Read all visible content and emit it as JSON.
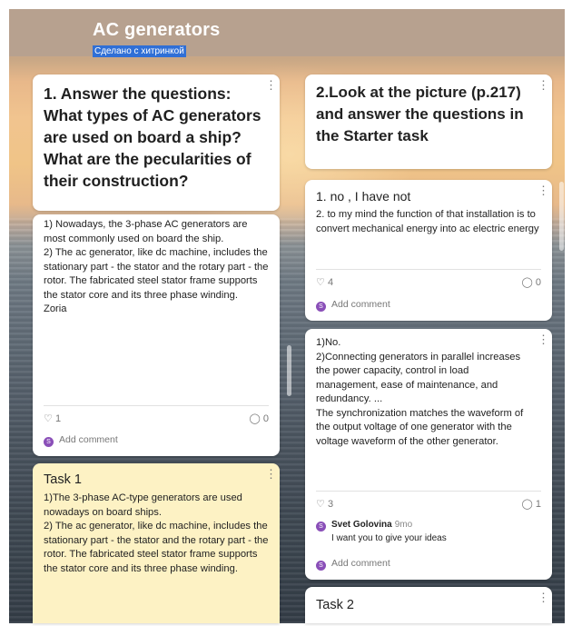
{
  "header": {
    "title": "AC generators",
    "subtitle": "Сделано с хитринкой"
  },
  "columns": [
    {
      "title": "1. Answer the questions: What types of AC generators are used on board a ship? What are the pecularities of their construction?",
      "posts": [
        {
          "title": "",
          "body": "1) Nowadays, the 3-phase AC generators are most commonly used on board the ship.\n2) The ac generator, like dc machine, includes the stationary part - the stator and the rotary part - the rotor. The fabricated steel stator frame supports the stator core and its three phase winding.\nZoria",
          "likes": "1",
          "comments": "0",
          "add_comment": "Add comment"
        },
        {
          "title": "Task 1",
          "body": "1)The 3-phase AC-type generators are used nowadays on board ships.\n2) The ac generator, like dc machine, includes the stationary part - the stator and the rotary part - the rotor. The fabricated steel stator frame supports the stator core and its three phase winding."
        }
      ]
    },
    {
      "title": "2.Look at the picture (p.217) and answer the questions in the Starter task",
      "posts": [
        {
          "title": "1. no , I have not",
          "body": "2. to my mind the function of that installation is to convert mechanical energy into ac electric energy",
          "likes": "4",
          "comments": "0",
          "add_comment": "Add comment"
        },
        {
          "title": "",
          "body": "1)No.\n2)Connecting generators in parallel increases the power capacity, control in load management, ease of maintenance, and redundancy. ...\nThe synchronization matches the waveform of the output voltage of one generator with the voltage waveform of the other generator.",
          "likes": "3",
          "comments": "1",
          "comment": {
            "author": "Svet Golovina",
            "time": "9mo",
            "text": "I want you to give your ideas"
          },
          "add_comment": "Add comment"
        },
        {
          "title": "Task 2"
        }
      ]
    }
  ],
  "icons": {
    "menu": "more-vertical-icon",
    "like": "heart-icon",
    "comment": "comment-icon",
    "avatar": "user-avatar"
  },
  "colors": {
    "header_bg": "#b7a18f",
    "subtitle_highlight": "#2f6fd6",
    "task_card_bg": "#fdf2c4",
    "avatar": "#8a4fb8"
  }
}
